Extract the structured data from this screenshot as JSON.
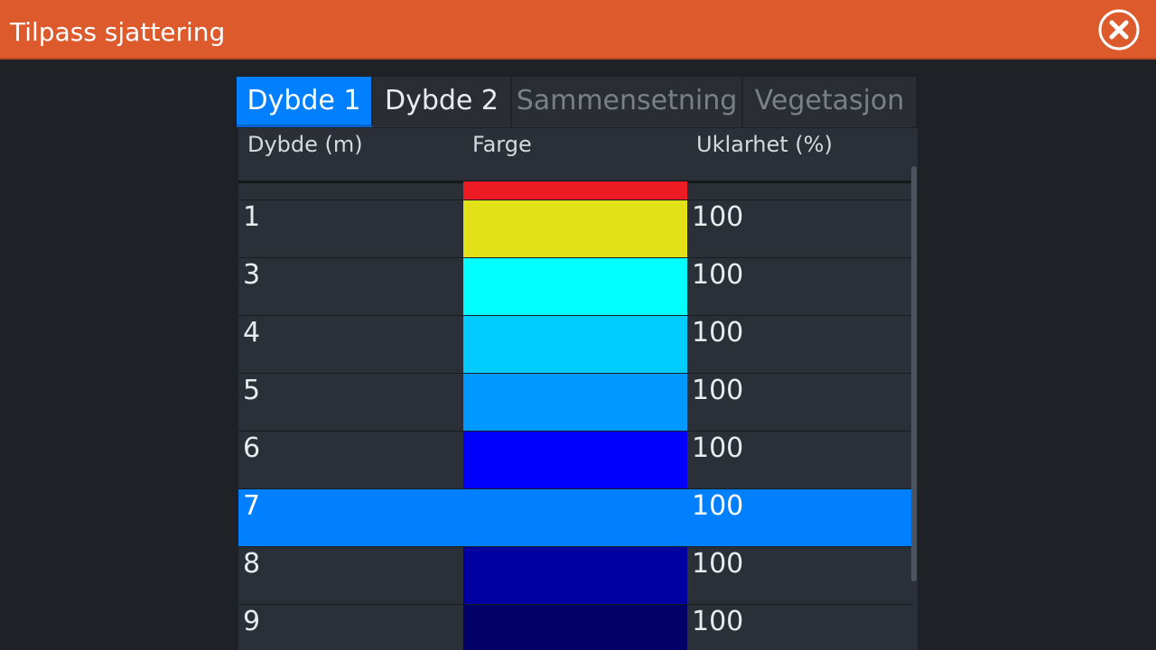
{
  "window": {
    "title": "Tilpass sjattering",
    "close_icon": "close-circle-icon"
  },
  "tabs": [
    {
      "label": "Dybde 1",
      "state": "active"
    },
    {
      "label": "Dybde 2",
      "state": "normal"
    },
    {
      "label": "Sammensetning",
      "state": "disabled"
    },
    {
      "label": "Vegetasjon",
      "state": "disabled"
    }
  ],
  "table": {
    "columns": [
      "Dybde (m)",
      "Farge",
      "Uklarhet (%)"
    ],
    "rows": [
      {
        "depth": "",
        "color": "#ed1c24",
        "opacity": ""
      },
      {
        "depth": "1",
        "color": "#e2e016",
        "opacity": "100"
      },
      {
        "depth": "3",
        "color": "#00ffff",
        "opacity": "100"
      },
      {
        "depth": "4",
        "color": "#00ccff",
        "opacity": "100"
      },
      {
        "depth": "5",
        "color": "#0099ff",
        "opacity": "100"
      },
      {
        "depth": "6",
        "color": "#0000ff",
        "opacity": "100"
      },
      {
        "depth": "7",
        "color": "#0080ff",
        "opacity": "100",
        "selected": true
      },
      {
        "depth": "8",
        "color": "#0000a0",
        "opacity": "100"
      },
      {
        "depth": "9",
        "color": "#000066",
        "opacity": "100"
      }
    ]
  },
  "colors": {
    "title_bar": "#dd5a2d",
    "accent": "#0080ff",
    "background": "#1e2226",
    "panel": "#2b3038"
  }
}
